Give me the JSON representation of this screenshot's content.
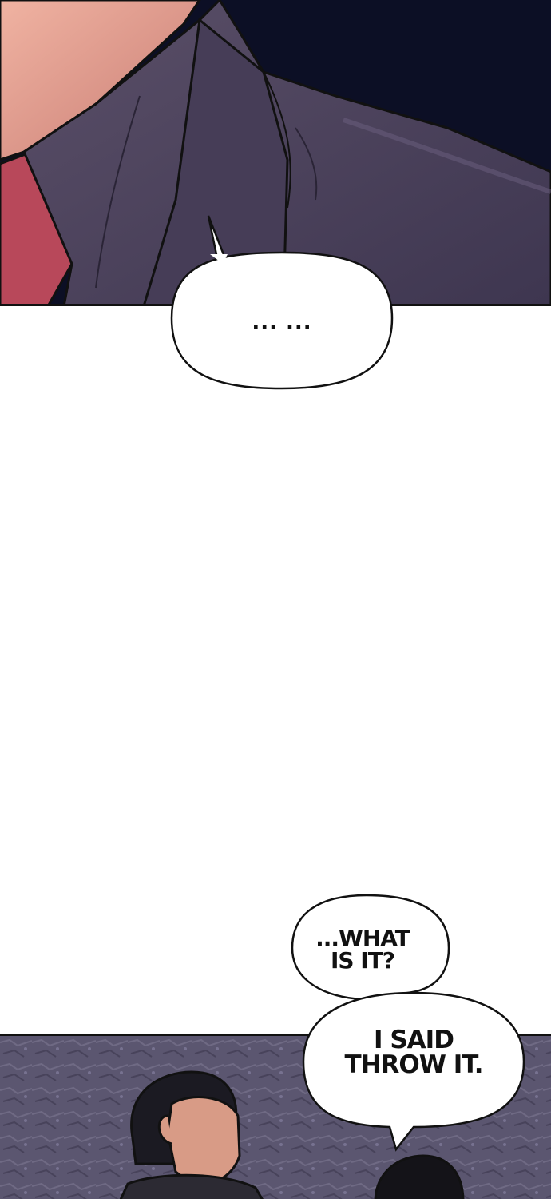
{
  "panels": [
    {
      "id": "panel-top",
      "description": "dark close-up of suit shoulder and collar"
    },
    {
      "id": "panel-white",
      "description": "blank white gutter"
    },
    {
      "id": "panel-bottom",
      "description": "characters against textured stone wall"
    }
  ],
  "bubbles": {
    "ellipsis": "... ...",
    "what_is_it": "...WHAT\nIS IT?",
    "throw_it": "I SAID\nTHROW IT."
  },
  "colors": {
    "night_bg": "#0c0f25",
    "suit": "#4a4058",
    "shirt": "#b8485a",
    "skin": "#e6a394",
    "wall": "#5b5670"
  }
}
